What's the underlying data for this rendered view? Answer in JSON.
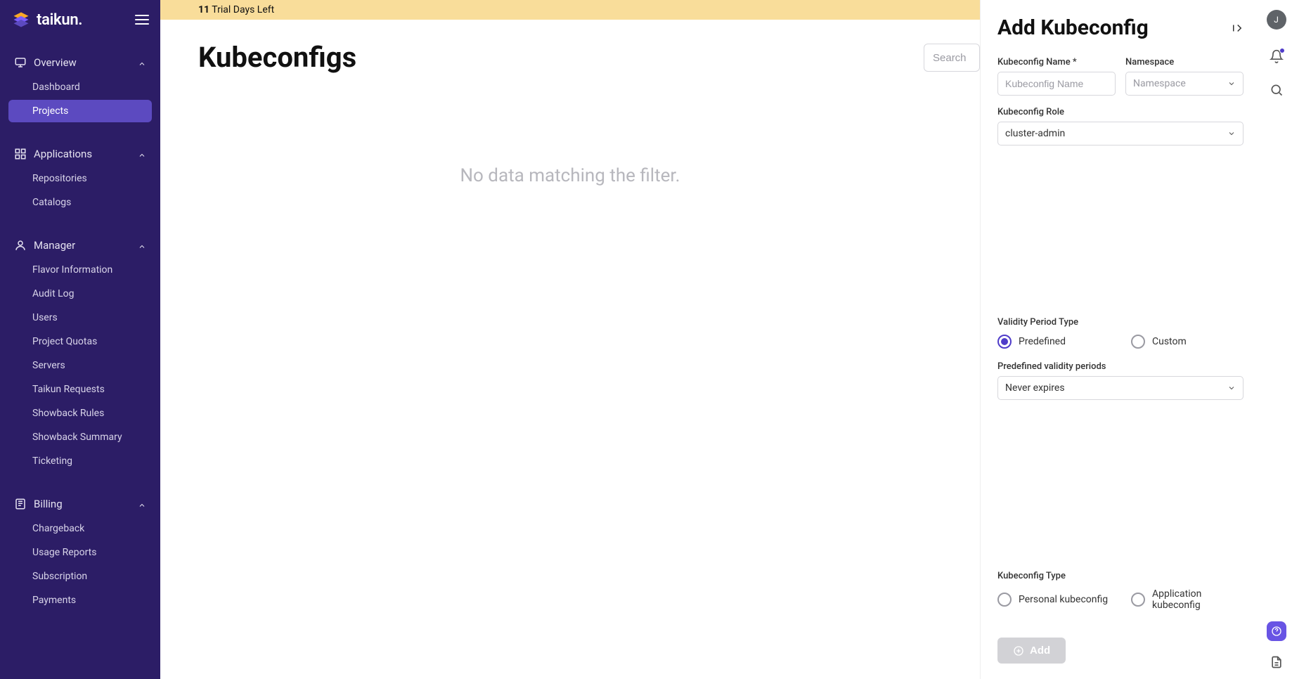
{
  "logo_text": "taikun.",
  "trial_banner": {
    "days": "11",
    "text": "Trial Days Left"
  },
  "page_title": "Kubeconfigs",
  "search_placeholder": "Search",
  "no_data_text": "No data matching the filter.",
  "sidebar": {
    "sections": [
      {
        "title": "Overview",
        "icon": "monitor-icon",
        "items": [
          {
            "label": "Dashboard",
            "active": false
          },
          {
            "label": "Projects",
            "active": true
          }
        ]
      },
      {
        "title": "Applications",
        "icon": "apps-icon",
        "items": [
          {
            "label": "Repositories"
          },
          {
            "label": "Catalogs"
          }
        ]
      },
      {
        "title": "Manager",
        "icon": "user-icon",
        "items": [
          {
            "label": "Flavor Information"
          },
          {
            "label": "Audit Log"
          },
          {
            "label": "Users"
          },
          {
            "label": "Project Quotas"
          },
          {
            "label": "Servers"
          },
          {
            "label": "Taikun Requests"
          },
          {
            "label": "Showback Rules"
          },
          {
            "label": "Showback Summary"
          },
          {
            "label": "Ticketing"
          }
        ]
      },
      {
        "title": "Billing",
        "icon": "billing-icon",
        "items": [
          {
            "label": "Chargeback"
          },
          {
            "label": "Usage Reports"
          },
          {
            "label": "Subscription"
          },
          {
            "label": "Payments"
          }
        ]
      }
    ]
  },
  "drawer": {
    "title": "Add Kubeconfig",
    "kubeconfig_name_label": "Kubeconfig Name *",
    "kubeconfig_name_placeholder": "Kubeconfig Name",
    "namespace_label": "Namespace",
    "namespace_placeholder": "Namespace",
    "kubeconfig_role_label": "Kubeconfig Role",
    "kubeconfig_role_value": "cluster-admin",
    "validity_period_type_label": "Validity Period Type",
    "predefined_label": "Predefined",
    "custom_label": "Custom",
    "predefined_validity_periods_label": "Predefined validity periods",
    "predefined_validity_periods_value": "Never expires",
    "kubeconfig_type_label": "Kubeconfig Type",
    "personal_label": "Personal kubeconfig",
    "application_label": "Application kubeconfig",
    "add_button": "Add"
  },
  "avatar_initial": "J"
}
